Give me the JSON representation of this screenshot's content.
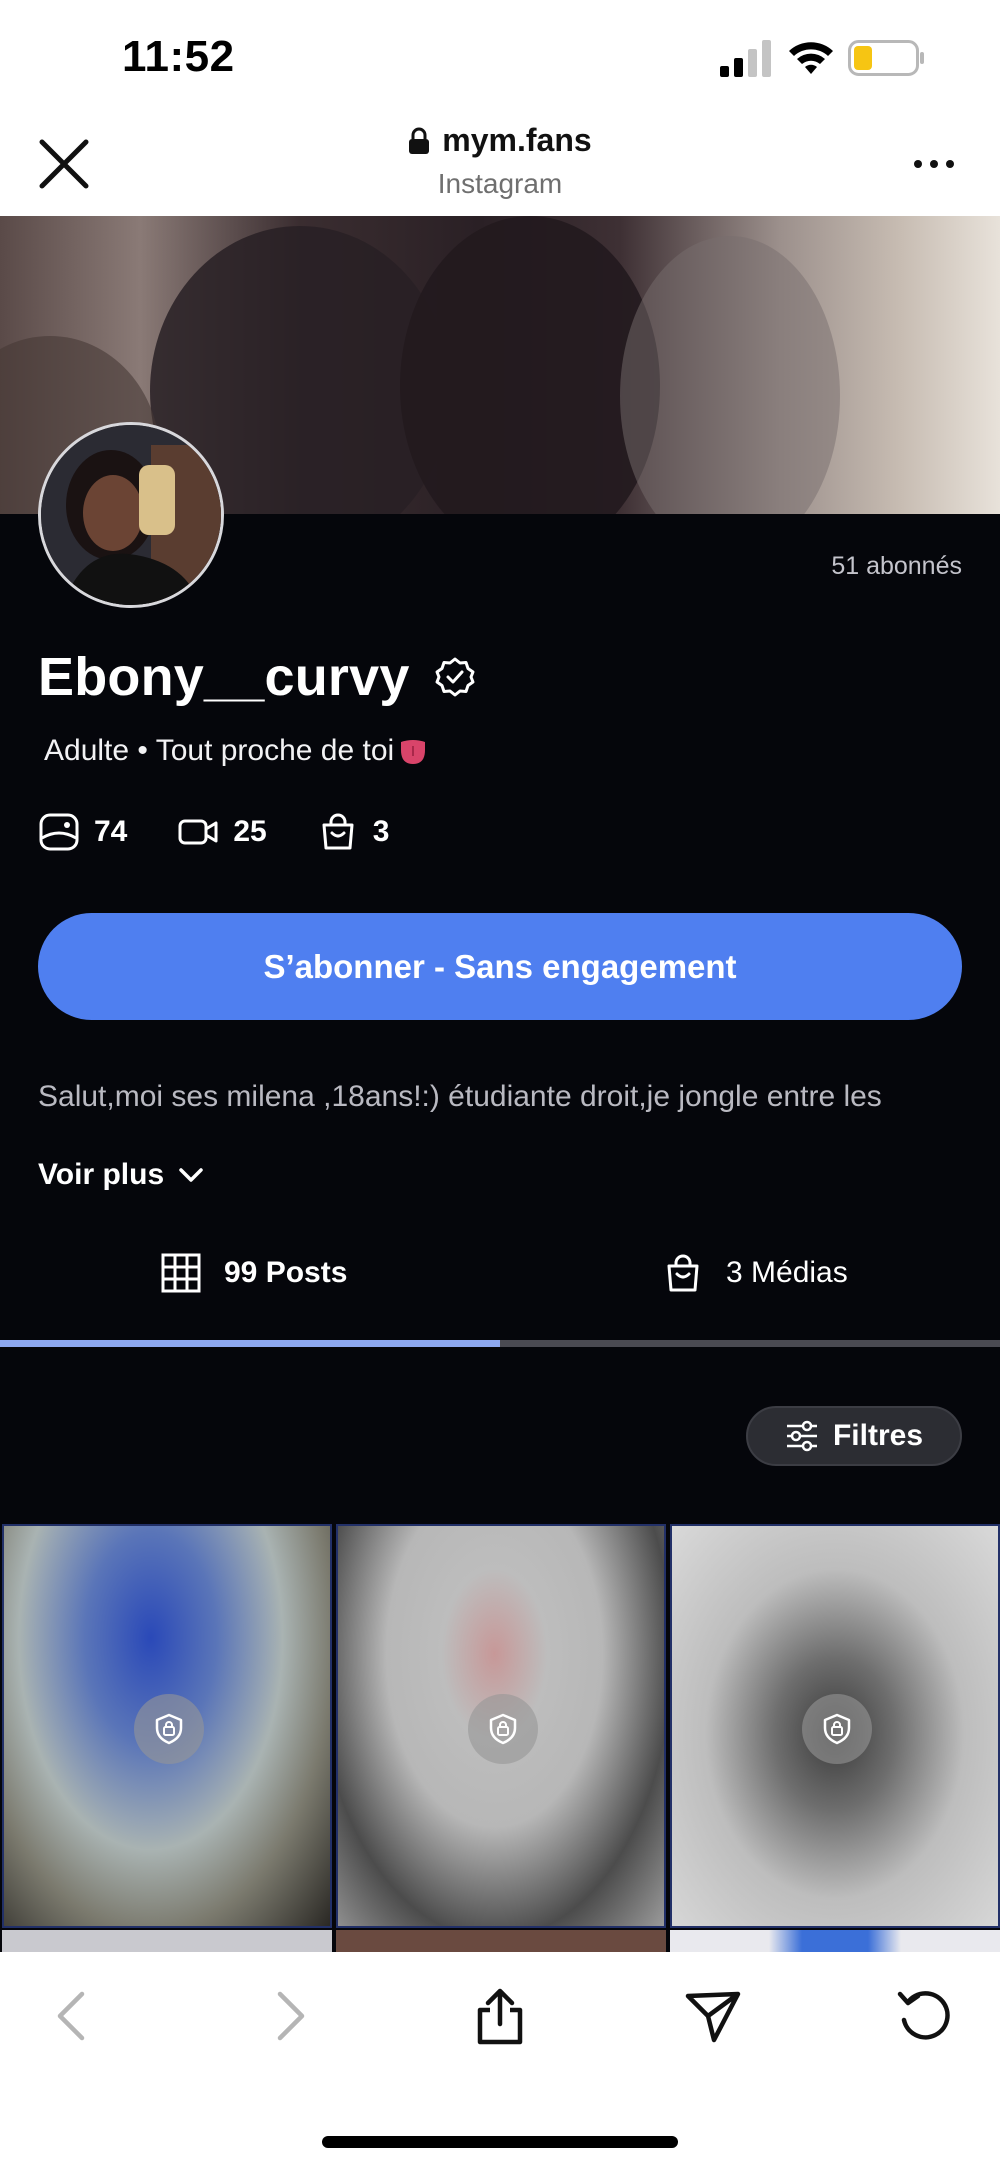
{
  "status_bar": {
    "time": "11:52",
    "icons": [
      "signal-icon",
      "wifi-icon",
      "battery-icon"
    ]
  },
  "browser": {
    "domain": "mym.fans",
    "subtitle": "Instagram"
  },
  "profile": {
    "followers": "51 abonnés",
    "name": "Ebony__curvy",
    "tagline": "Adulte • Tout proche de toi",
    "stats": [
      {
        "icon": "photo-icon",
        "value": "74"
      },
      {
        "icon": "video-icon",
        "value": "25"
      },
      {
        "icon": "bag-icon",
        "value": "3"
      }
    ],
    "subscribe_label": "S’abonner - Sans engagement",
    "bio": "Salut,moi ses milena ,18ans!:) étudiante droit,je jongle entre les",
    "see_more": "Voir plus"
  },
  "tabs": [
    {
      "label": "99 Posts",
      "active": true,
      "icon": "grid-icon"
    },
    {
      "label": "3 Médias",
      "active": false,
      "icon": "bag-icon"
    }
  ],
  "filter_label": "Filtres",
  "colors": {
    "accent": "#4f7ff0",
    "background": "#05060b",
    "tab_indicator": "#8ea8f0"
  }
}
